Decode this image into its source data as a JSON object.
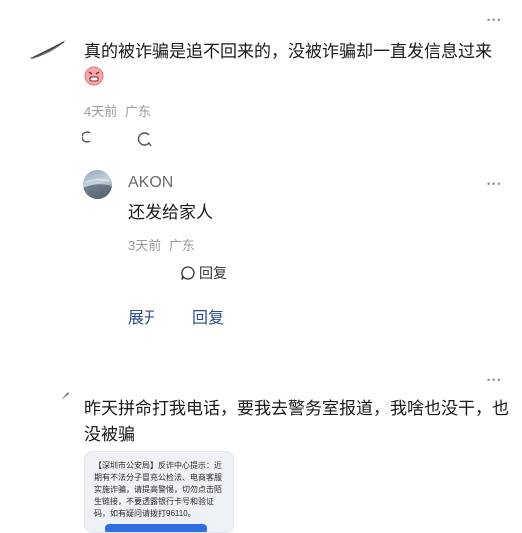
{
  "comment1": {
    "text": "真的被诈骗是追不回来的，没被诈骗却一直发信息过来",
    "time": "4天前",
    "location": "广东",
    "more_icon": "more-dots-icon",
    "emoji": "angry-face-emoji"
  },
  "reply1": {
    "username": "AKON",
    "text": "还发给家人",
    "time": "3天前",
    "location": "广东",
    "reply_label": "回复"
  },
  "thread": {
    "expand_label": "展开",
    "reply_label": "回复"
  },
  "comment2": {
    "text": "昨天拼命打我电话，要我去警务室报道，我啥也没干，也没被骗",
    "image_text": "【深圳市公安局】反诈中心提示：近期有不法分子冒充公检法、电商客服实施诈骗，请提高警惕，切勿点击陌生链接，不要透露银行卡号和验证码，如有疑问请拨打96110。"
  },
  "colors": {
    "link": "#2a4d8f",
    "muted": "#999999",
    "image_button": "#2f6fe4"
  }
}
